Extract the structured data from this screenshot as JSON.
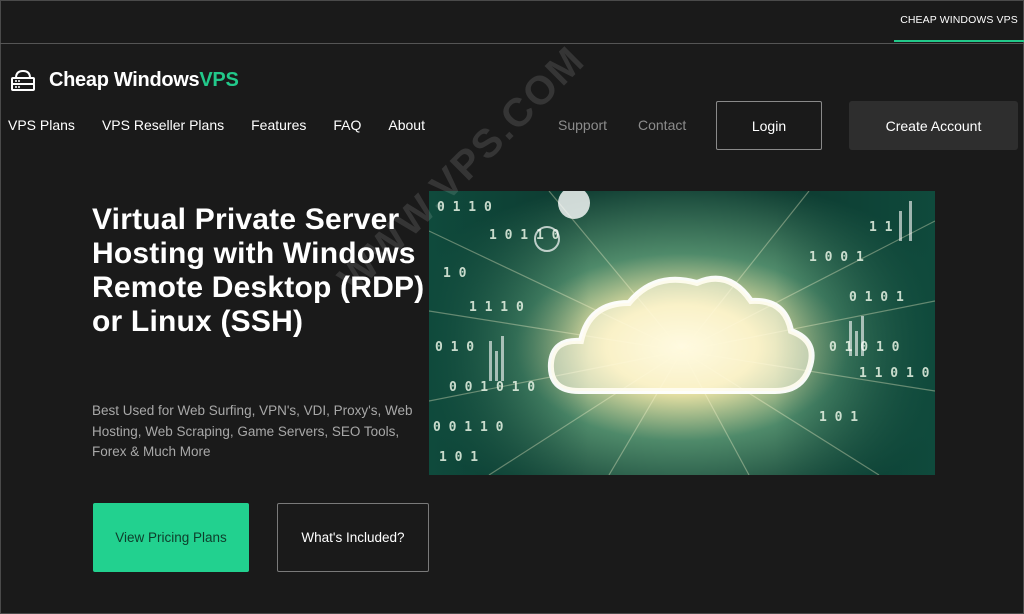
{
  "topbar": {
    "tab_label": "CHEAP WINDOWS VPS"
  },
  "logo": {
    "text_main": "Cheap Windows",
    "text_accent": "VPS",
    "icon": "server-icon"
  },
  "nav": {
    "items": [
      {
        "label": "VPS Plans"
      },
      {
        "label": "VPS Reseller Plans"
      },
      {
        "label": "Features"
      },
      {
        "label": "FAQ"
      },
      {
        "label": "About"
      }
    ],
    "support_label": "Support",
    "contact_label": "Contact",
    "login_label": "Login",
    "create_account_label": "Create Account"
  },
  "hero": {
    "title": "Virtual Private Server Hosting with Windows Remote Desktop (RDP) or Linux (SSH)",
    "subtitle": "Best Used for Web Surfing, VPN's, VDI, Proxy's, Web Hosting, Web Scraping, Game Servers, SEO Tools, Forex & Much More",
    "primary_button": "View Pricing Plans",
    "secondary_button": "What's Included?",
    "image_icon": "cloud-data-image"
  },
  "watermark": "WWW.VPS.COM",
  "colors": {
    "accent": "#22c98a",
    "background": "#1a1a1a",
    "button_dark": "#2e2e2e"
  }
}
